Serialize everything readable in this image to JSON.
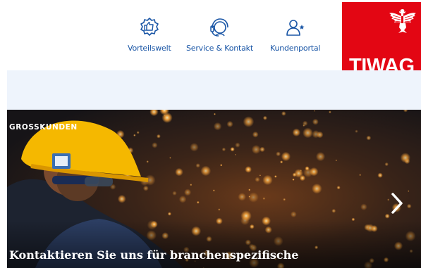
{
  "nav": {
    "items": [
      {
        "label": "Vorteilswelt",
        "icon": "thumbs-up-badge-icon"
      },
      {
        "label": "Service & Kontakt",
        "icon": "headset-icon"
      },
      {
        "label": "Kundenportal",
        "icon": "user-star-icon"
      }
    ]
  },
  "logo": {
    "text": "TIWAG"
  },
  "hero": {
    "category": "GROSSKUNDEN",
    "headline": "Kontaktieren Sie uns für branchenspezifische",
    "next_icon": "chevron-right-icon"
  },
  "colors": {
    "brand_red": "#e30613",
    "link_blue": "#1a56a6",
    "light_band": "#eef4fc"
  }
}
